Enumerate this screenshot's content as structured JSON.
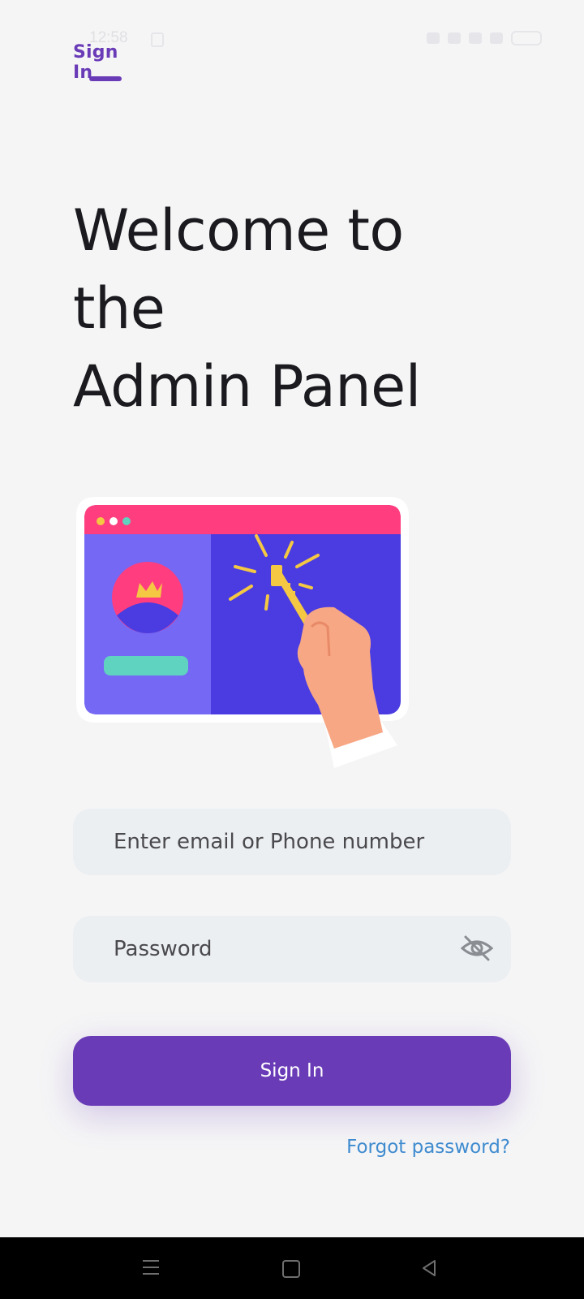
{
  "status_bar": {
    "time": "12:58"
  },
  "tab": {
    "label": "Sign In"
  },
  "welcome": {
    "line1": "Welcome to",
    "line2": "the",
    "line3": "Admin Panel"
  },
  "form": {
    "email_placeholder": "Enter email or Phone number",
    "password_placeholder": "Password",
    "signin_label": "Sign In",
    "forgot_label": "Forgot password?"
  },
  "icons": {
    "password_toggle": "eye-off-icon",
    "nav_menu": "menu-icon",
    "nav_home": "home-icon",
    "nav_back": "back-icon"
  },
  "colors": {
    "accent": "#6a3bb7",
    "link": "#3f8bcf",
    "field_bg": "#eceff2",
    "background": "#f5f5f6",
    "illustration_header": "#ff3d7f",
    "illustration_left": "#7468f5",
    "illustration_right": "#4a3ce1"
  }
}
